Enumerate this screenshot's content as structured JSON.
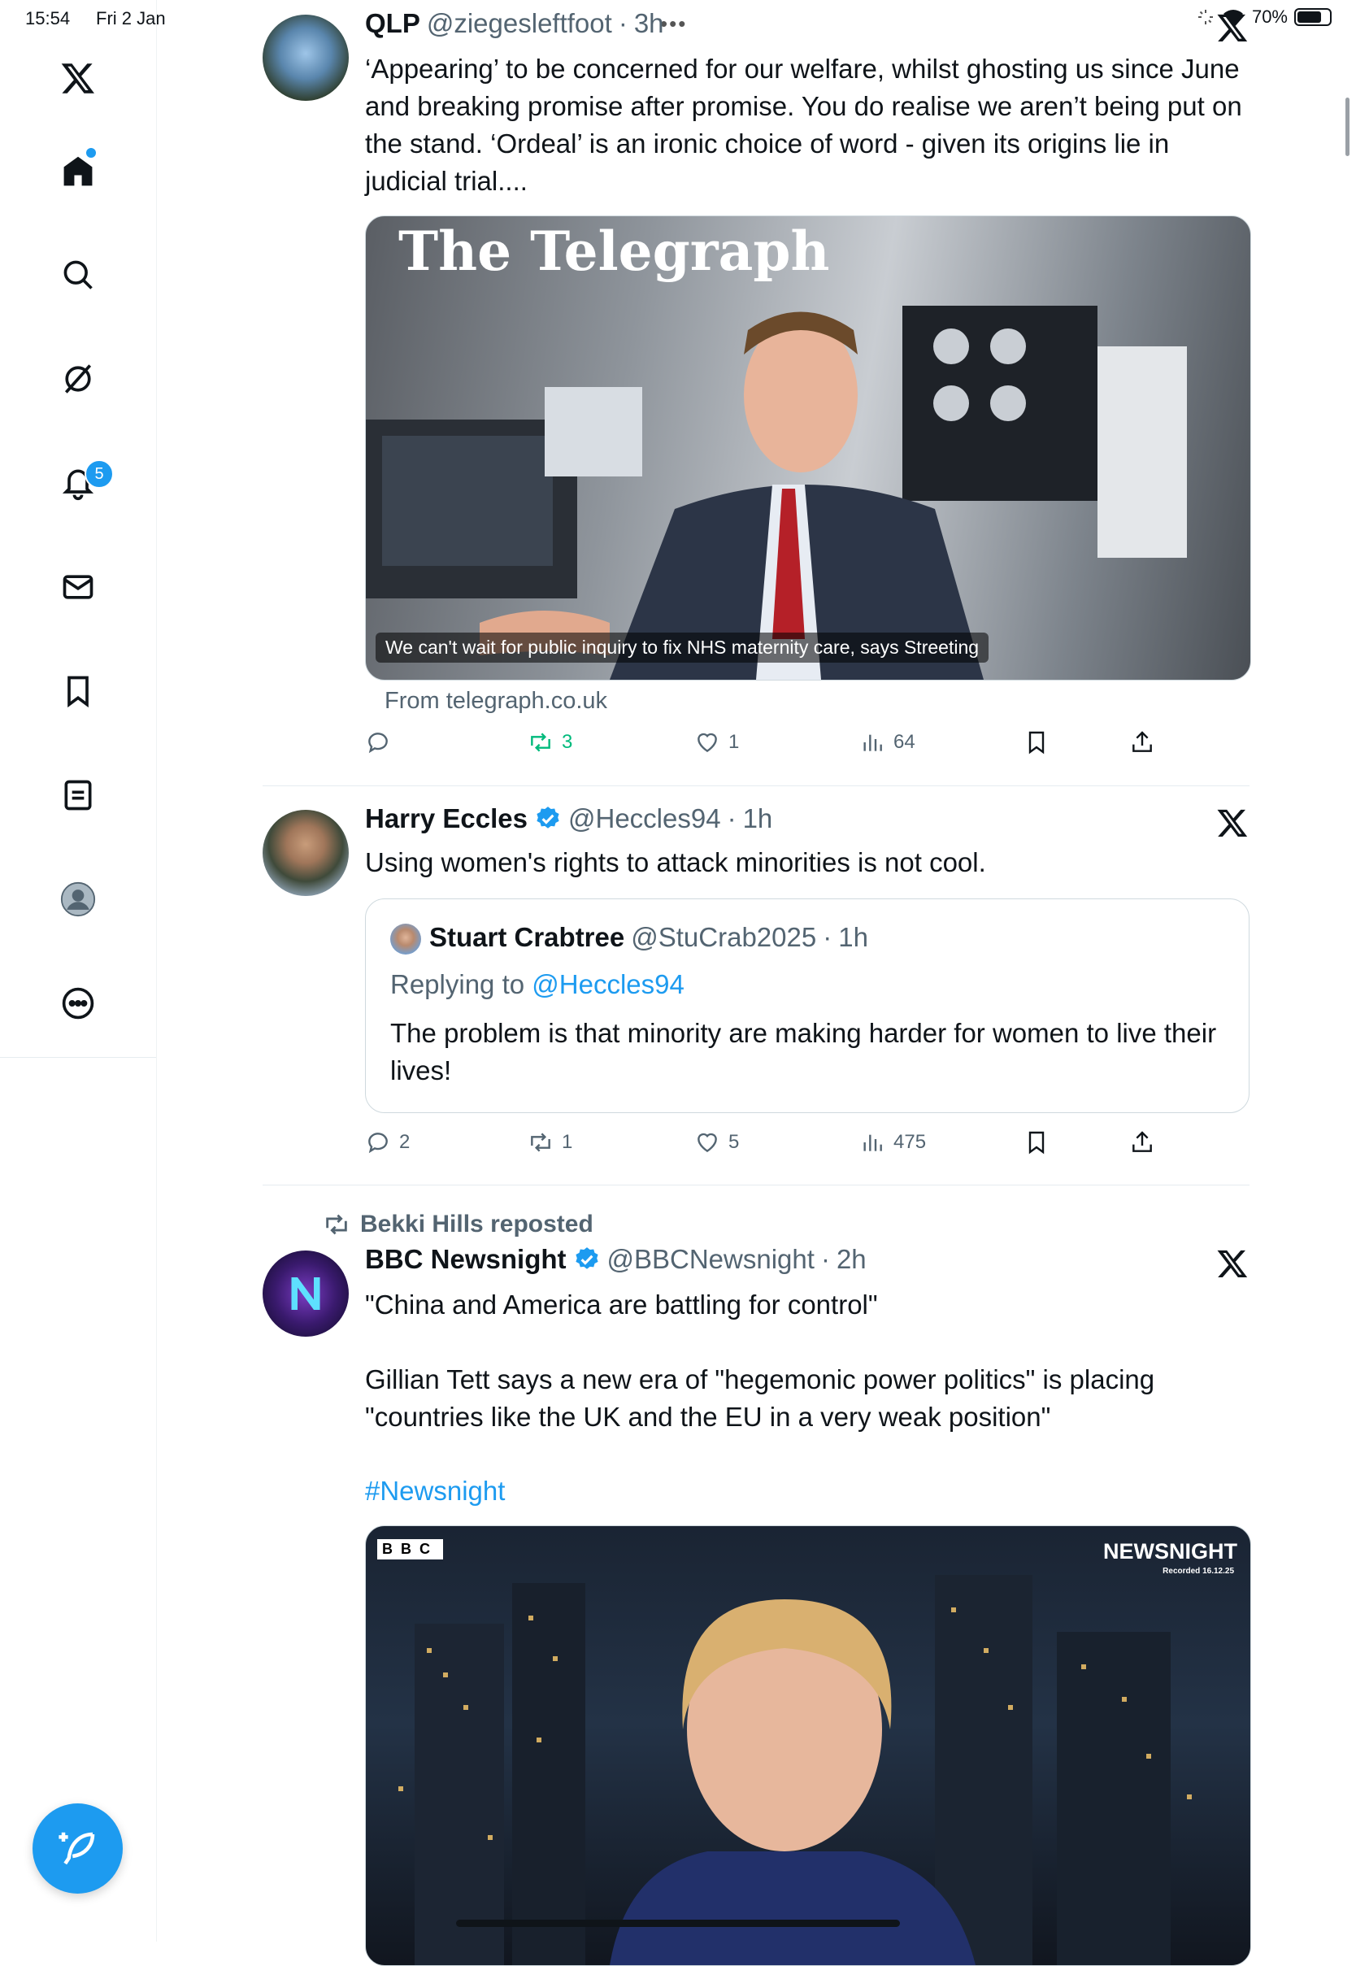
{
  "status_bar": {
    "time": "15:54",
    "date": "Fri 2 Jan",
    "battery": "70%"
  },
  "sidebar": {
    "notifications_badge": "5",
    "items": [
      "home",
      "explore",
      "grok",
      "notifications",
      "messages",
      "bookmarks",
      "lists",
      "profile",
      "more"
    ]
  },
  "tweets": [
    {
      "name": "QLP",
      "handle": "@ziegesleftfoot",
      "time": "3h",
      "text": "‘Appearing’ to be concerned for our welfare, whilst ghosting us since June and breaking promise after promise. You do realise we aren’t being put on the stand. ‘Ordeal’ is an ironic choice of word - given its origins lie in judicial trial....",
      "card": {
        "masthead": "The Telegraph",
        "headline": "We can't wait for public inquiry to fix NHS maternity care, says Streeting",
        "source": "From telegraph.co.uk"
      },
      "stats": {
        "replies": "",
        "reposts": "3",
        "likes": "1",
        "views": "64"
      }
    },
    {
      "name": "Harry Eccles",
      "handle": "@Heccles94",
      "time": "1h",
      "text": "Using women's rights to attack minorities is not cool.",
      "quote": {
        "name": "Stuart Crabtree",
        "handle": "@StuCrab2025",
        "time": "1h",
        "replying_prefix": "Replying to",
        "replying_to": "@Heccles94",
        "text": "The problem is that minority are making harder for women to live their lives!"
      },
      "stats": {
        "replies": "2",
        "reposts": "1",
        "likes": "5",
        "views": "475"
      }
    },
    {
      "repost_by": "Bekki Hills reposted",
      "name": "BBC Newsnight",
      "handle": "@BBCNewsnight",
      "time": "2h",
      "text_1": "\"China and America are battling for control\"",
      "text_2": "Gillian Tett says a new era of \"hegemonic power politics\" is placing \"countries like the UK and the EU in a very weak position\"",
      "hashtag": "#Newsnight",
      "video": {
        "logo": "BBC",
        "brand": "NEWSNIGHT",
        "recorded": "Recorded 16.12.25"
      }
    }
  ],
  "colors": {
    "accent": "#1d9bf0",
    "text": "#0f1419",
    "muted": "#536471",
    "repost_green": "#00ba7c"
  }
}
